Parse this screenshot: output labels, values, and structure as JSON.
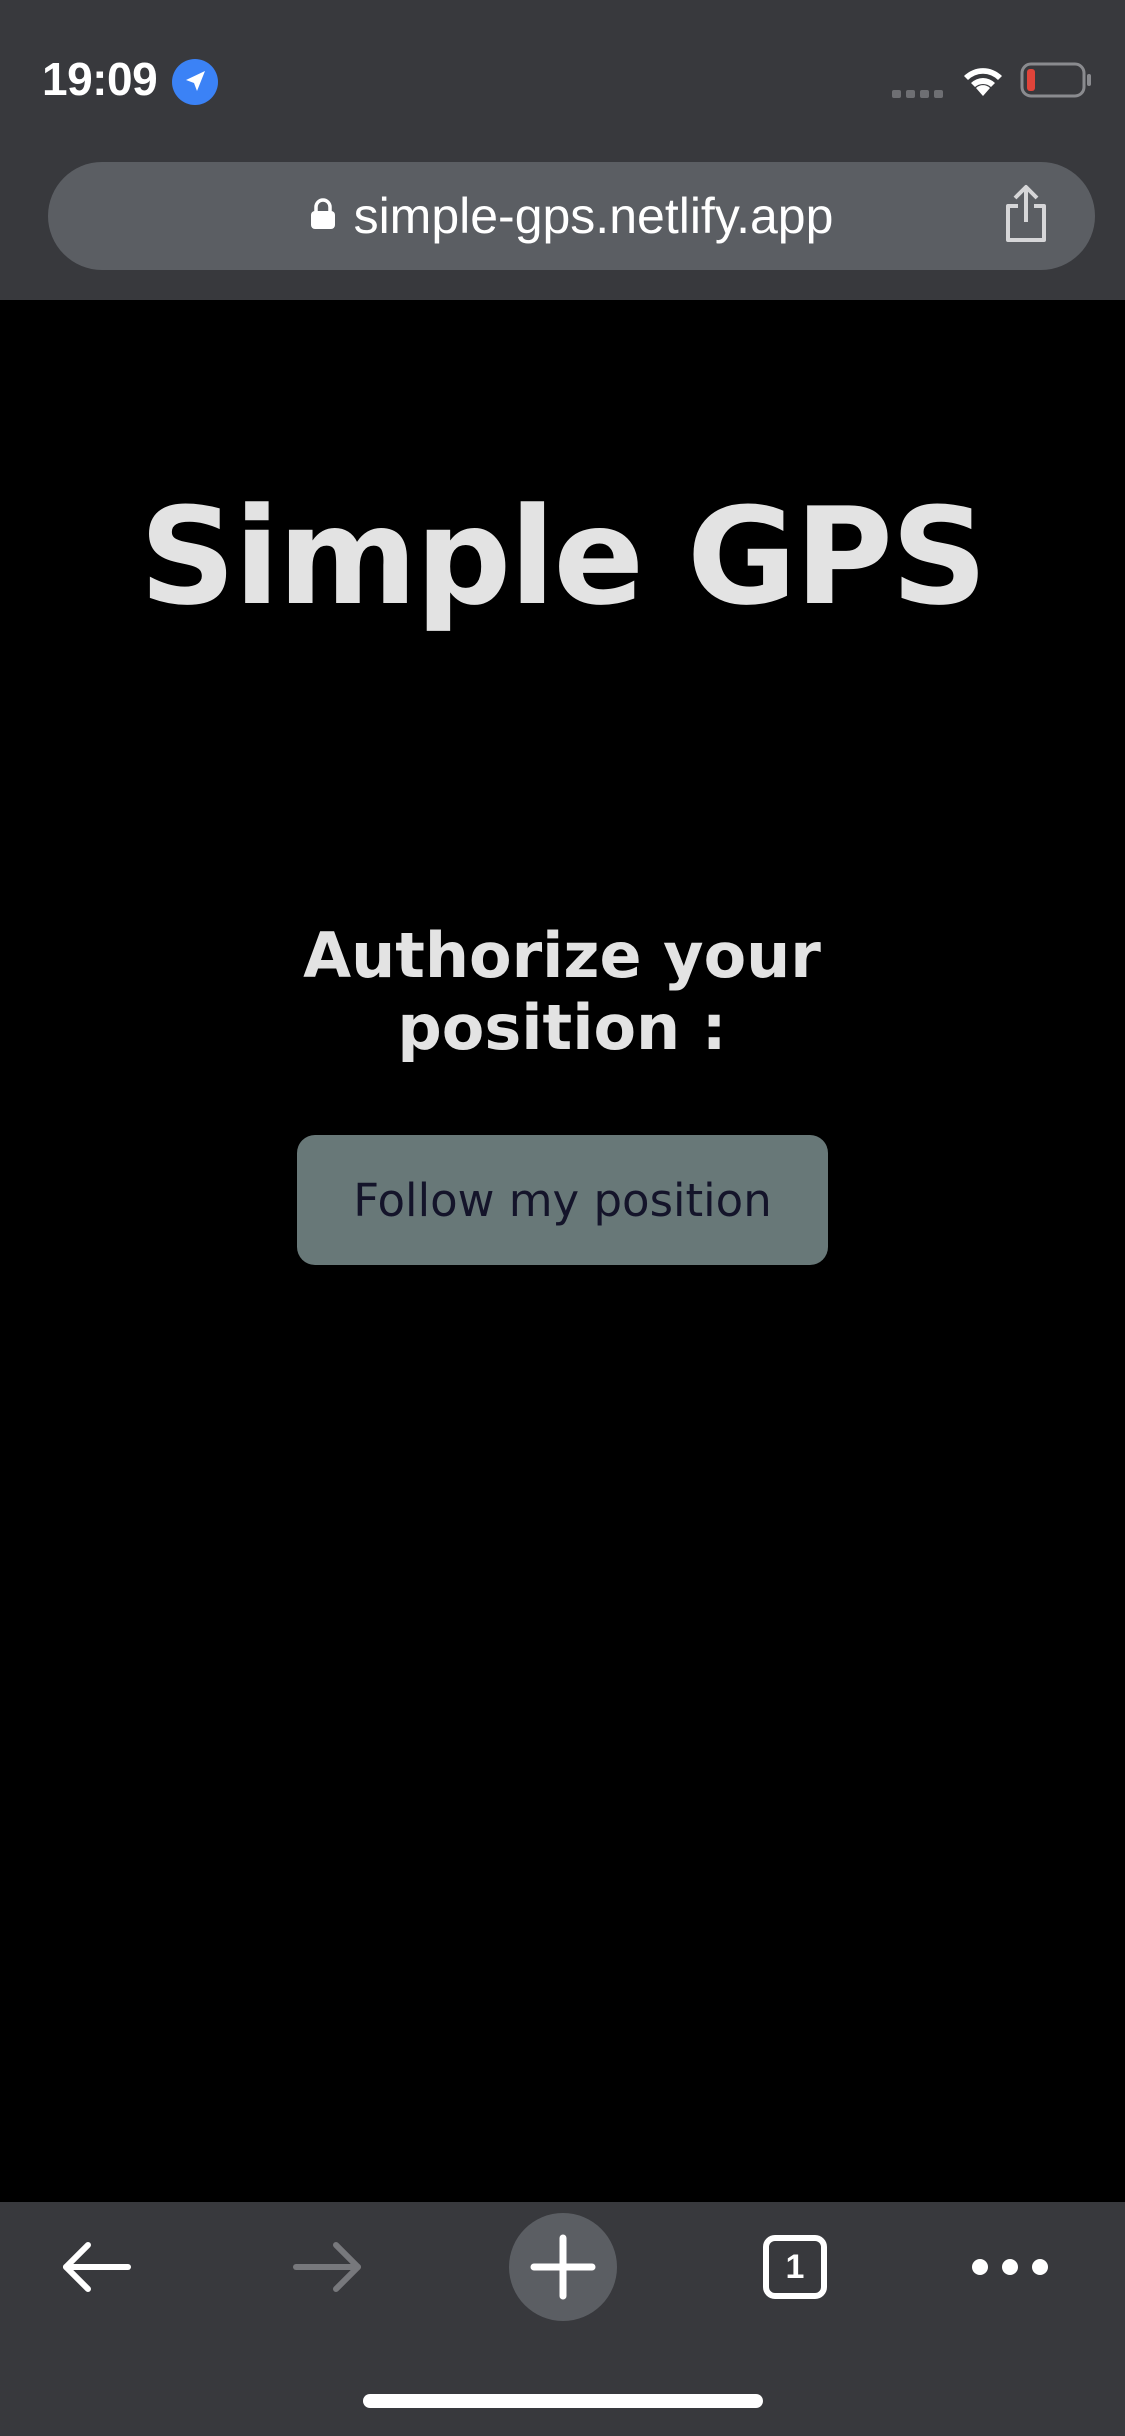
{
  "status_bar": {
    "time": "19:09",
    "location_icon": "location-arrow-icon",
    "signal_icon": "cellular-signal-icon",
    "wifi_icon": "wifi-icon",
    "battery_icon": "battery-low-icon",
    "battery_level_color": "#e0443a",
    "location_icon_color": "#3b82f6"
  },
  "browser": {
    "url": "simple-gps.netlify.app",
    "lock_icon": "lock-icon",
    "share_icon": "share-icon",
    "chrome_color": "#38393d",
    "url_bar_color": "#5b5e63"
  },
  "page": {
    "title": "Simple GPS",
    "authorize_heading": "Authorize your position :",
    "follow_button_label": "Follow my position",
    "background_color": "#000000",
    "text_color": "#e3e3e3",
    "button_color": "#687878",
    "button_text_color": "#14142a"
  },
  "toolbar": {
    "back_icon": "arrow-left-icon",
    "forward_icon": "arrow-right-icon",
    "new_tab_icon": "plus-icon",
    "tab_count": "1",
    "more_icon": "more-dots-icon"
  }
}
